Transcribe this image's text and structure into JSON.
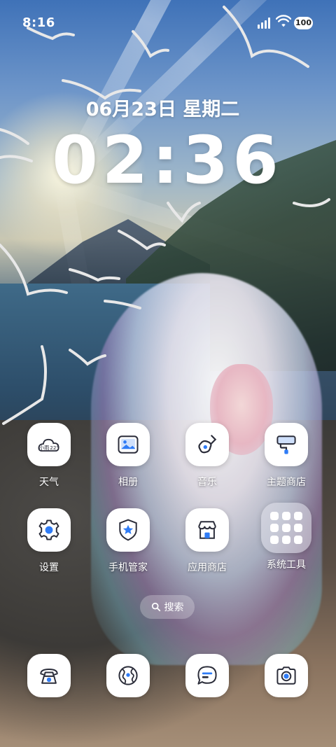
{
  "status_bar": {
    "time": "8:16",
    "battery": "100"
  },
  "lockscreen": {
    "date": "06月23日  星期二",
    "clock": "02:36"
  },
  "weather_widget": {
    "condition": "小雨",
    "temp": "22°"
  },
  "apps": [
    {
      "label": "天气",
      "icon": "weather-icon"
    },
    {
      "label": "相册",
      "icon": "gallery-icon"
    },
    {
      "label": "音乐",
      "icon": "music-icon"
    },
    {
      "label": "主题商店",
      "icon": "theme-store-icon"
    },
    {
      "label": "设置",
      "icon": "settings-gear-icon"
    },
    {
      "label": "手机管家",
      "icon": "phone-manager-icon"
    },
    {
      "label": "应用商店",
      "icon": "app-store-icon"
    },
    {
      "label": "系统工具",
      "icon": "folder-icon"
    }
  ],
  "search": {
    "label": "搜索"
  },
  "dock": [
    {
      "icon": "phone-icon"
    },
    {
      "icon": "browser-globe-icon"
    },
    {
      "icon": "messages-icon"
    },
    {
      "icon": "camera-icon"
    }
  ],
  "colors": {
    "tile": "#ffffff",
    "icon_blue": "#2f7cf6",
    "icon_dark": "#2b2d3a"
  }
}
